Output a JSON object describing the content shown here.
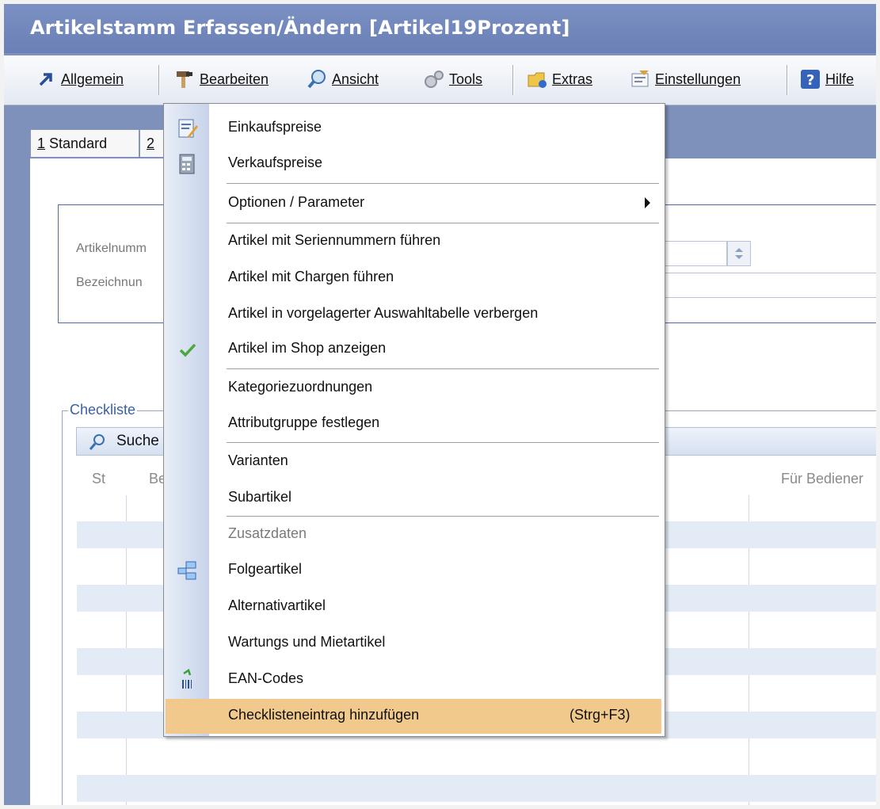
{
  "window": {
    "title": "Artikelstamm Erfassen/Ändern [Artikel19Prozent]"
  },
  "menubar": {
    "items": [
      {
        "label": "Allgemein",
        "icon": "arrow-icon"
      },
      {
        "label": "Bearbeiten",
        "icon": "hammer-icon"
      },
      {
        "label": "Ansicht",
        "icon": "magnifier-icon"
      },
      {
        "label": "Tools",
        "icon": "gears-icon"
      },
      {
        "label": "Extras",
        "icon": "folder-icon"
      },
      {
        "label": "Einstellungen",
        "icon": "settings-icon"
      },
      {
        "label": "Hilfe",
        "icon": "help-icon"
      }
    ]
  },
  "tabs": [
    {
      "num": "1",
      "label": "Standard"
    },
    {
      "num": "2",
      "label": ""
    }
  ],
  "form": {
    "artikelnummer_label": "Artikelnumm",
    "bezeichnung_label": "Bezeichnun"
  },
  "checklist": {
    "legend": "Checkliste",
    "search_label": "Suche",
    "columns": [
      "St",
      "Bez",
      "Für Bediener"
    ]
  },
  "dropdown": {
    "items": [
      {
        "label": "Einkaufspreise",
        "icon": "edit-icon"
      },
      {
        "label": "Verkaufspreise",
        "icon": "calculator-icon"
      },
      {
        "label": "Optionen / Parameter",
        "submenu": true
      },
      {
        "label": "Artikel mit Seriennummern führen"
      },
      {
        "label": "Artikel mit Chargen führen"
      },
      {
        "label": "Artikel in vorgelagerter Auswahltabelle verbergen"
      },
      {
        "label": "Artikel im Shop anzeigen",
        "checked": true
      },
      {
        "label": "Kategoriezuordnungen"
      },
      {
        "label": "Attributgruppe festlegen"
      },
      {
        "label": "Varianten"
      },
      {
        "label": "Subartikel"
      },
      {
        "label": "Zusatzdaten",
        "disabled": true
      },
      {
        "label": "Folgeartikel",
        "icon": "tree-icon"
      },
      {
        "label": "Alternativartikel"
      },
      {
        "label": "Wartungs und Mietartikel"
      },
      {
        "label": "EAN-Codes",
        "icon": "barcode-icon"
      },
      {
        "label": "Checklisteneintrag hinzufügen",
        "shortcut": "(Strg+F3)",
        "highlighted": true
      }
    ]
  }
}
